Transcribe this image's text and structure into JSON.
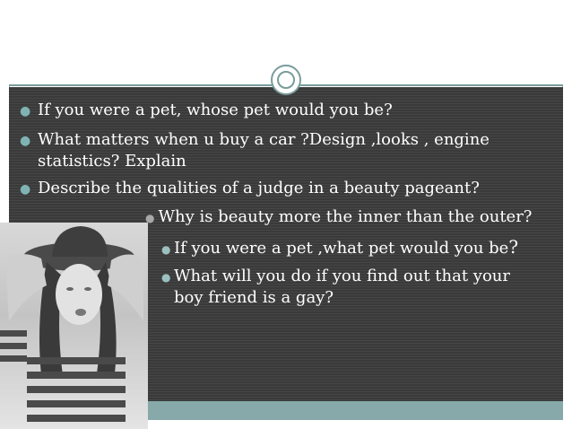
{
  "slide": {
    "bullets_level1": [
      "If you were a pet, whose pet would you be?",
      "What matters when u buy a car ?Design ,looks , engine",
      "statistics? Explain",
      "Describe the qualities of a judge in a beauty pageant?"
    ],
    "bullet_level1_sub": "Why is beauty more the inner than the outer?",
    "bullets_level2": [
      "If you were a pet ,what pet would you be",
      "?",
      "What will you do if you find out that your",
      "boy friend is a gay?"
    ]
  },
  "colors": {
    "content_background": "#3a3a3a",
    "accent_teal": "#87a9a9",
    "bullet_marker": "#7fb3b3",
    "text": "#ffffff"
  },
  "icons": {
    "bullet": "filled-circle",
    "ornament": "double-ring-circle"
  }
}
